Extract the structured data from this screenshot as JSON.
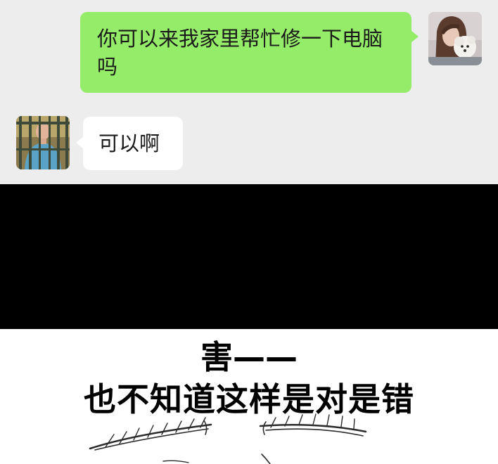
{
  "chat": {
    "messages": [
      {
        "sender": "me",
        "avatar_icon": "girl-with-puppy-avatar-icon",
        "text": "你可以来我家里帮忙修一下电脑吗"
      },
      {
        "sender": "other",
        "avatar_icon": "man-behind-bars-avatar-icon",
        "text": "可以啊"
      }
    ],
    "colors": {
      "background": "#ededed",
      "my_bubble": "#95ec69",
      "other_bubble": "#ffffff"
    }
  },
  "meme": {
    "caption_line1": "害——",
    "caption_line2": "也不知道这样是对是错",
    "sketch_icon": "eyebrows-sketch-icon"
  }
}
